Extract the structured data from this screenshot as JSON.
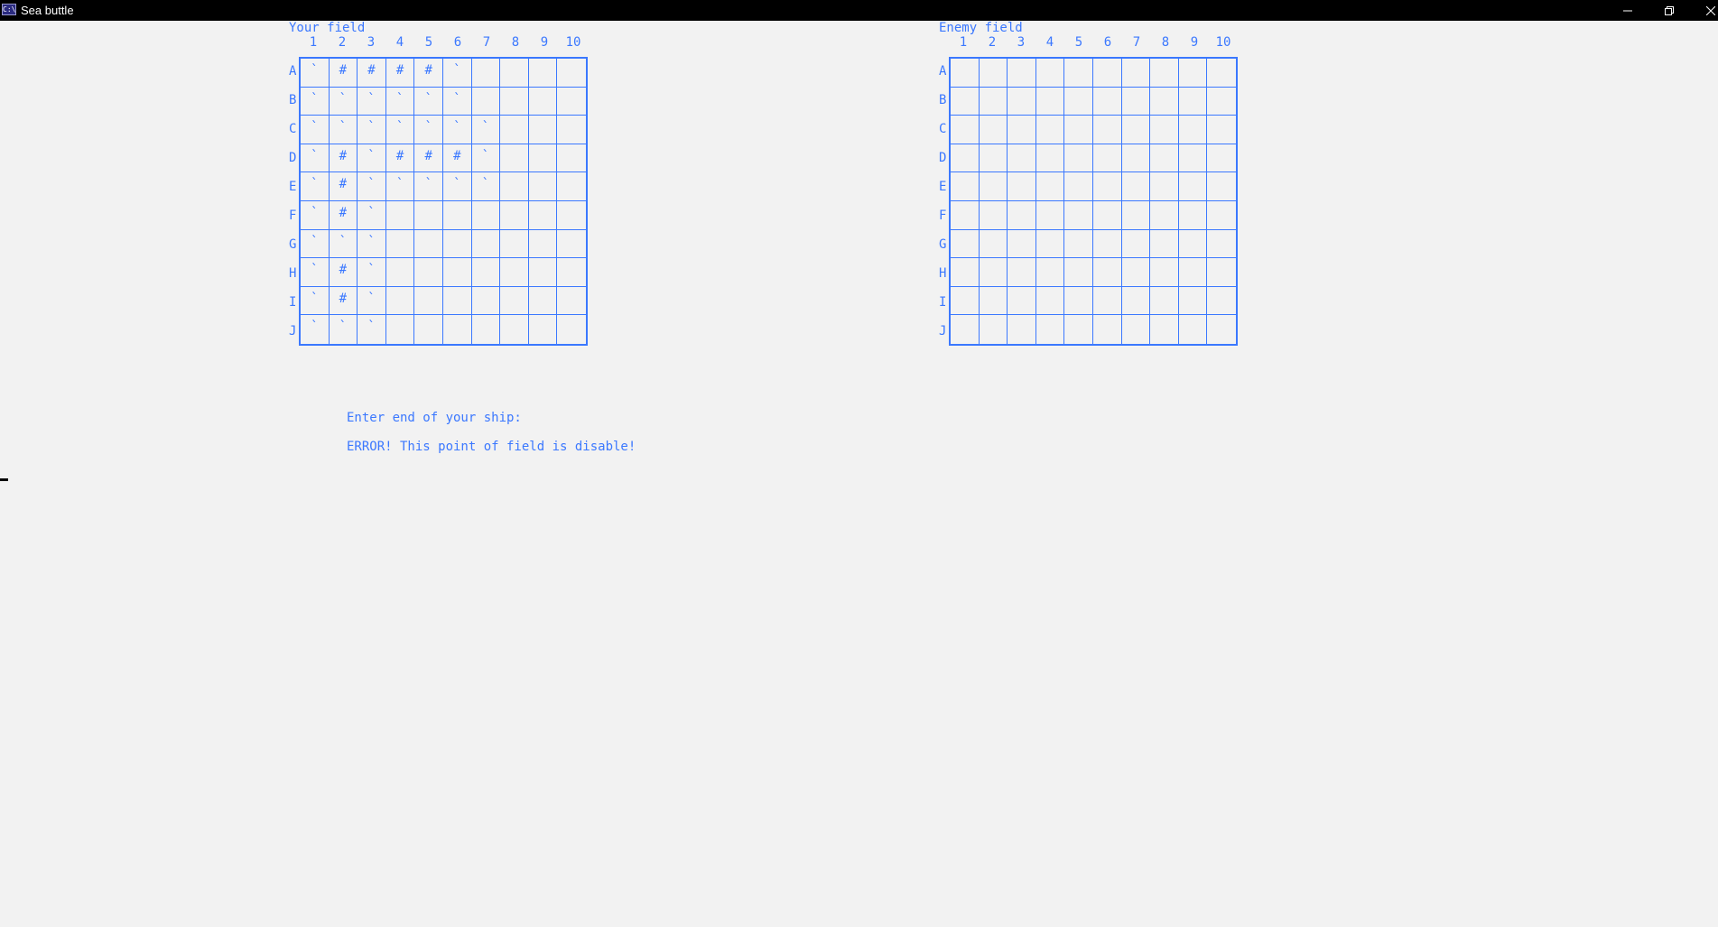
{
  "window": {
    "title": "Sea buttle",
    "icon_text": "C:\\",
    "icon": "console-icon",
    "controls": [
      "minimize-icon",
      "restore-icon",
      "close-icon"
    ]
  },
  "colors": {
    "console_text": "#3b78ff",
    "background": "#f2f2f2",
    "titlebar": "#000000"
  },
  "columns": [
    "1",
    "2",
    "3",
    "4",
    "5",
    "6",
    "7",
    "8",
    "9",
    "10"
  ],
  "rows": [
    "A",
    "B",
    "C",
    "D",
    "E",
    "F",
    "G",
    "H",
    "I",
    "J"
  ],
  "your_field": {
    "title": "Your field",
    "cells": [
      [
        "`",
        "#",
        "#",
        "#",
        "#",
        "`",
        "",
        "",
        "",
        ""
      ],
      [
        "`",
        "`",
        "`",
        "`",
        "`",
        "`",
        "",
        "",
        "",
        ""
      ],
      [
        "`",
        "`",
        "`",
        "`",
        "`",
        "`",
        "`",
        "",
        "",
        ""
      ],
      [
        "`",
        "#",
        "`",
        "#",
        "#",
        "#",
        "`",
        "",
        "",
        ""
      ],
      [
        "`",
        "#",
        "`",
        "`",
        "`",
        "`",
        "`",
        "",
        "",
        ""
      ],
      [
        "`",
        "#",
        "`",
        "",
        "",
        "",
        "",
        "",
        "",
        ""
      ],
      [
        "`",
        "`",
        "`",
        "",
        "",
        "",
        "",
        "",
        "",
        ""
      ],
      [
        "`",
        "#",
        "`",
        "",
        "",
        "",
        "",
        "",
        "",
        ""
      ],
      [
        "`",
        "#",
        "`",
        "",
        "",
        "",
        "",
        "",
        "",
        ""
      ],
      [
        "`",
        "`",
        "`",
        "",
        "",
        "",
        "",
        "",
        "",
        ""
      ]
    ]
  },
  "enemy_field": {
    "title": "Enemy field",
    "cells": [
      [
        "",
        "",
        "",
        "",
        "",
        "",
        "",
        "",
        "",
        ""
      ],
      [
        "",
        "",
        "",
        "",
        "",
        "",
        "",
        "",
        "",
        ""
      ],
      [
        "",
        "",
        "",
        "",
        "",
        "",
        "",
        "",
        "",
        ""
      ],
      [
        "",
        "",
        "",
        "",
        "",
        "",
        "",
        "",
        "",
        ""
      ],
      [
        "",
        "",
        "",
        "",
        "",
        "",
        "",
        "",
        "",
        ""
      ],
      [
        "",
        "",
        "",
        "",
        "",
        "",
        "",
        "",
        "",
        ""
      ],
      [
        "",
        "",
        "",
        "",
        "",
        "",
        "",
        "",
        "",
        ""
      ],
      [
        "",
        "",
        "",
        "",
        "",
        "",
        "",
        "",
        "",
        ""
      ],
      [
        "",
        "",
        "",
        "",
        "",
        "",
        "",
        "",
        "",
        ""
      ],
      [
        "",
        "",
        "",
        "",
        "",
        "",
        "",
        "",
        "",
        ""
      ]
    ]
  },
  "messages": {
    "prompt": "Enter end of your ship:",
    "error": "ERROR! This point of field is disable!"
  }
}
